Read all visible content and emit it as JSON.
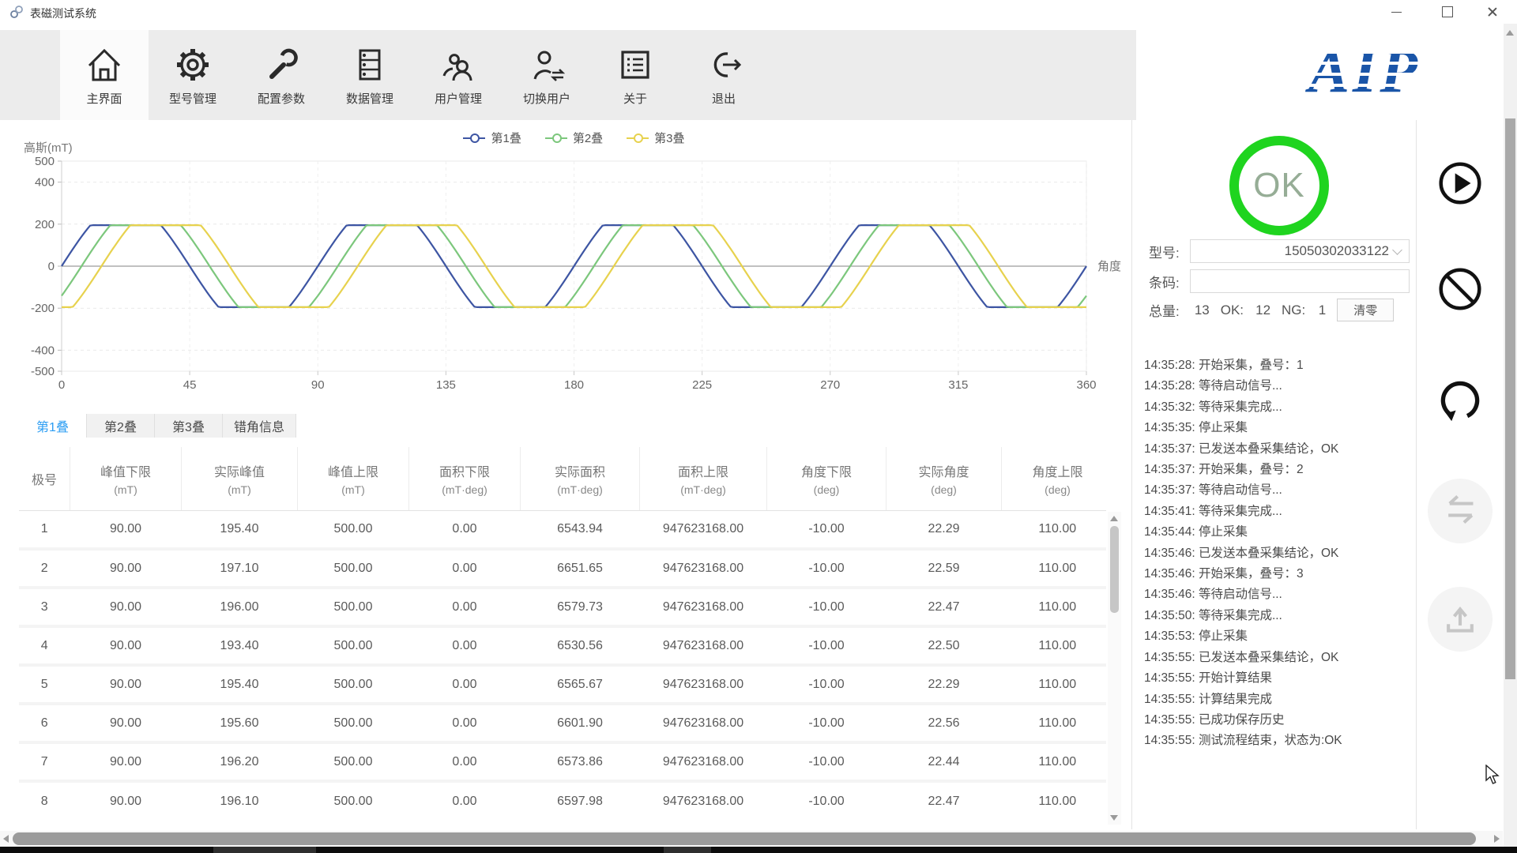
{
  "window": {
    "title": "表磁测试系统"
  },
  "toolbar": {
    "logo": "AIP",
    "logo_color": "#1a55a8",
    "items": [
      {
        "label": "主界面",
        "icon": "home-icon",
        "active": true
      },
      {
        "label": "型号管理",
        "icon": "gear-icon",
        "active": false
      },
      {
        "label": "配置参数",
        "icon": "wrench-icon",
        "active": false
      },
      {
        "label": "数据管理",
        "icon": "database-icon",
        "active": false
      },
      {
        "label": "用户管理",
        "icon": "users-icon",
        "active": false
      },
      {
        "label": "切换用户",
        "icon": "switch-user-icon",
        "active": false
      },
      {
        "label": "关于",
        "icon": "about-icon",
        "active": false
      },
      {
        "label": "退出",
        "icon": "exit-icon",
        "active": false
      }
    ]
  },
  "chart_data": {
    "type": "line",
    "title": "高斯(mT)",
    "xlabel": "角度",
    "xlim": [
      0,
      360
    ],
    "ylim": [
      -500,
      500
    ],
    "x_ticks": [
      0,
      45,
      90,
      135,
      180,
      225,
      270,
      315,
      360
    ],
    "y_ticks": [
      500,
      400,
      200,
      0,
      -200,
      -400,
      -500
    ],
    "grid": true,
    "legend_position": "top",
    "series": [
      {
        "name": "第1叠",
        "color": "#3d55a3",
        "waveform": "clipped-sine",
        "amplitude_mT": 195,
        "period_deg": 90,
        "phase_deg": 0,
        "drive_amplitude": 300
      },
      {
        "name": "第2叠",
        "color": "#7cc77c",
        "waveform": "clipped-sine",
        "amplitude_mT": 195,
        "period_deg": 90,
        "phase_deg": 7,
        "drive_amplitude": 300
      },
      {
        "name": "第3叠",
        "color": "#e7d24e",
        "waveform": "clipped-sine",
        "amplitude_mT": 195,
        "period_deg": 90,
        "phase_deg": 14,
        "drive_amplitude": 300
      }
    ]
  },
  "tabs": [
    {
      "label": "第1叠",
      "active": true
    },
    {
      "label": "第2叠",
      "active": false
    },
    {
      "label": "第3叠",
      "active": false
    },
    {
      "label": "错角信息",
      "active": false
    }
  ],
  "table": {
    "headers": [
      {
        "title": "极号",
        "unit": ""
      },
      {
        "title": "峰值下限",
        "unit": "(mT)"
      },
      {
        "title": "实际峰值",
        "unit": "(mT)"
      },
      {
        "title": "峰值上限",
        "unit": "(mT)"
      },
      {
        "title": "面积下限",
        "unit": "(mT·deg)"
      },
      {
        "title": "实际面积",
        "unit": "(mT·deg)"
      },
      {
        "title": "面积上限",
        "unit": "(mT·deg)"
      },
      {
        "title": "角度下限",
        "unit": "(deg)"
      },
      {
        "title": "实际角度",
        "unit": "(deg)"
      },
      {
        "title": "角度上限",
        "unit": "(deg)"
      }
    ],
    "rows": [
      [
        "1",
        "90.00",
        "195.40",
        "500.00",
        "0.00",
        "6543.94",
        "947623168.00",
        "-10.00",
        "22.29",
        "110.00"
      ],
      [
        "2",
        "90.00",
        "197.10",
        "500.00",
        "0.00",
        "6651.65",
        "947623168.00",
        "-10.00",
        "22.59",
        "110.00"
      ],
      [
        "3",
        "90.00",
        "196.00",
        "500.00",
        "0.00",
        "6579.73",
        "947623168.00",
        "-10.00",
        "22.47",
        "110.00"
      ],
      [
        "4",
        "90.00",
        "193.40",
        "500.00",
        "0.00",
        "6530.56",
        "947623168.00",
        "-10.00",
        "22.50",
        "110.00"
      ],
      [
        "5",
        "90.00",
        "195.40",
        "500.00",
        "0.00",
        "6565.67",
        "947623168.00",
        "-10.00",
        "22.29",
        "110.00"
      ],
      [
        "6",
        "90.00",
        "195.60",
        "500.00",
        "0.00",
        "6601.90",
        "947623168.00",
        "-10.00",
        "22.56",
        "110.00"
      ],
      [
        "7",
        "90.00",
        "196.20",
        "500.00",
        "0.00",
        "6573.86",
        "947623168.00",
        "-10.00",
        "22.44",
        "110.00"
      ],
      [
        "8",
        "90.00",
        "196.10",
        "500.00",
        "0.00",
        "6597.98",
        "947623168.00",
        "-10.00",
        "22.47",
        "110.00"
      ]
    ]
  },
  "panel": {
    "status": "OK",
    "status_ring_color": "#1fd41f",
    "fields": {
      "model_label": "型号:",
      "model_value": "15050302033122",
      "barcode_label": "条码:",
      "barcode_value": ""
    },
    "counters": {
      "total_label": "总量:",
      "total": "13",
      "ok_label": "OK:",
      "ok": "12",
      "ng_label": "NG:",
      "ng": "1",
      "clear_button": "清零"
    },
    "log": [
      "14:35:28: 开始采集，叠号：1",
      "14:35:28: 等待启动信号...",
      "14:35:32: 等待采集完成...",
      "14:35:35: 停止采集",
      "14:35:37: 已发送本叠采集结论，OK",
      "14:35:37: 开始采集，叠号：2",
      "14:35:37: 等待启动信号...",
      "14:35:41: 等待采集完成...",
      "14:35:44: 停止采集",
      "14:35:46: 已发送本叠采集结论，OK",
      "14:35:46: 开始采集，叠号：3",
      "14:35:46: 等待启动信号...",
      "14:35:50: 等待采集完成...",
      "14:35:53: 停止采集",
      "14:35:55: 已发送本叠采集结论，OK",
      "14:35:55: 开始计算结果",
      "14:35:55: 计算结果完成",
      "14:35:55: 已成功保存历史",
      "14:35:55: 测试流程结束，状态为:OK"
    ]
  },
  "side_toolbar": [
    {
      "icon": "start-icon",
      "enabled": true
    },
    {
      "icon": "stop-icon",
      "enabled": true
    },
    {
      "icon": "reset-icon",
      "enabled": true
    },
    {
      "icon": "transfer-icon",
      "enabled": false
    },
    {
      "icon": "upload-icon",
      "enabled": false
    }
  ]
}
